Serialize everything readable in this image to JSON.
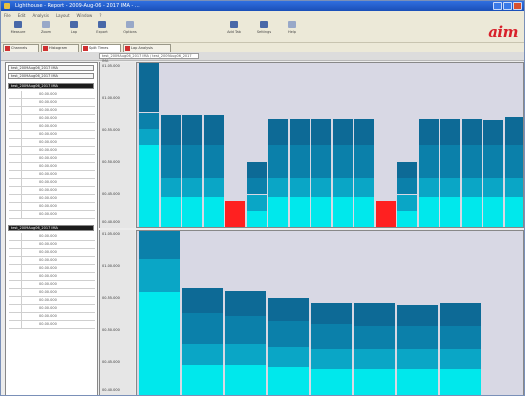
{
  "window": {
    "title": "Lighthouse - Report - 2009-Aug-06 - 2017 IMA - ..."
  },
  "menu": [
    "File",
    "Edit",
    "Analysis",
    "Layout",
    "Window",
    "?"
  ],
  "toolbar": {
    "tools": [
      {
        "label": "Measure",
        "icon": "measure-icon"
      },
      {
        "label": "Zoom",
        "icon": "zoom-icon"
      },
      {
        "label": "Lap",
        "icon": "lap-icon"
      },
      {
        "label": "Export",
        "icon": "export-icon"
      },
      {
        "label": "Options",
        "icon": "options-icon"
      },
      {
        "label": "Add Tab",
        "icon": "add-tab-icon"
      },
      {
        "label": "Settings",
        "icon": "settings-icon"
      },
      {
        "label": "Help",
        "icon": "help-icon"
      }
    ],
    "logo": "aim"
  },
  "tabs": [
    "Channels",
    "Histogram",
    "Split Times",
    "Lap Analysis"
  ],
  "path": "test_2009Aug06_2017 IMA / test_2009Aug06_2017 IMA",
  "sessions": {
    "top": [
      "test_2009Aug06_2017 IMA",
      "test_2009Aug06_2017 IMA"
    ],
    "group1": "test_2009Aug06_2017 IMA",
    "group2": "test_2009Aug06_2017 IMA"
  },
  "laps1": [
    "00.00.000",
    "00.00.000",
    "00.00.000",
    "00.00.000",
    "00.00.000",
    "00.00.000",
    "00.00.000",
    "00.00.000",
    "00.00.000",
    "00.00.000",
    "00.00.000",
    "00.00.000",
    "00.00.000",
    "00.00.000",
    "00.00.000",
    "00.00.000"
  ],
  "laps2": [
    "00.00.000",
    "00.00.000",
    "00.00.000",
    "00.00.000",
    "00.00.000",
    "00.00.000",
    "00.00.000",
    "00.00.000",
    "00.00.000",
    "00.00.000",
    "00.00.000",
    "00.00.000"
  ],
  "top_axis_ticks": [
    "01.05.000",
    "01.00.000",
    "00.55.000",
    "00.50.000",
    "00.45.000",
    "00.40.000"
  ],
  "bottom_axis_ticks": [
    "01.05.000",
    "01.00.000",
    "00.55.000",
    "00.50.000",
    "00.45.000",
    "00.40.000"
  ],
  "colors": {
    "split1": "#00e8ec",
    "split2": "#0aa6c6",
    "split3": "#0b80aa",
    "split4": "#0d6a96",
    "invalid": "#ff2020"
  },
  "top_laps": [
    [
      0.5,
      0.1,
      0.1,
      0.3
    ],
    [
      0.18,
      0.12,
      0.2,
      0.18
    ],
    [
      0.18,
      0.12,
      0.2,
      0.18
    ],
    [
      0.18,
      0.12,
      0.2,
      0.18
    ],
    [
      0.16
    ],
    [
      0.1,
      0.1,
      0.1,
      0.1
    ],
    [
      0.18,
      0.12,
      0.2,
      0.16
    ],
    [
      0.18,
      0.12,
      0.2,
      0.16
    ],
    [
      0.18,
      0.12,
      0.2,
      0.16
    ],
    [
      0.18,
      0.12,
      0.2,
      0.16
    ],
    [
      0.18,
      0.12,
      0.2,
      0.16
    ],
    [
      0.16
    ],
    [
      0.1,
      0.1,
      0.1,
      0.1
    ],
    [
      0.18,
      0.12,
      0.2,
      0.16
    ],
    [
      0.18,
      0.12,
      0.2,
      0.16
    ],
    [
      0.18,
      0.12,
      0.2,
      0.16
    ],
    [
      0.18,
      0.12,
      0.2,
      0.15
    ],
    [
      0.18,
      0.12,
      0.2,
      0.17
    ]
  ],
  "top_invalid": [
    4,
    11
  ],
  "bottom_laps": [
    [
      0.63,
      0.2,
      0.17
    ],
    [
      0.18,
      0.13,
      0.19,
      0.15
    ],
    [
      0.18,
      0.13,
      0.17,
      0.15
    ],
    [
      0.17,
      0.12,
      0.16,
      0.14
    ],
    [
      0.16,
      0.12,
      0.15,
      0.13
    ],
    [
      0.16,
      0.12,
      0.14,
      0.14
    ],
    [
      0.16,
      0.12,
      0.14,
      0.13
    ],
    [
      0.16,
      0.12,
      0.14,
      0.14
    ]
  ]
}
